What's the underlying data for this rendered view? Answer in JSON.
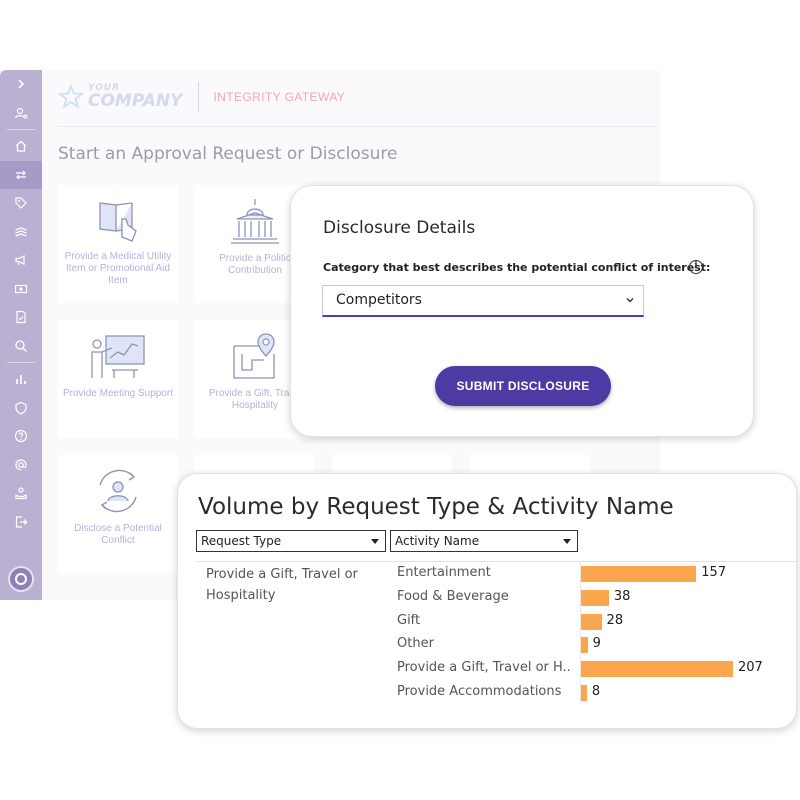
{
  "brand": {
    "your": "YOUR",
    "company": "COMPANY",
    "gateway": "INTEGRITY GATEWAY"
  },
  "sidebar": {
    "items": [
      {
        "icon": "chevron-right-icon"
      },
      {
        "icon": "user-settings-icon"
      },
      {
        "icon": "home-icon"
      },
      {
        "icon": "switch-icon"
      },
      {
        "icon": "tag-icon"
      },
      {
        "icon": "layers-icon"
      },
      {
        "icon": "megaphone-icon"
      },
      {
        "icon": "money-icon"
      },
      {
        "icon": "document-check-icon"
      },
      {
        "icon": "search-gear-icon"
      },
      {
        "icon": "bar-chart-icon"
      },
      {
        "icon": "shield-icon"
      },
      {
        "icon": "help-icon"
      },
      {
        "icon": "at-sign-icon"
      },
      {
        "icon": "hand-user-icon"
      },
      {
        "icon": "logout-icon"
      }
    ],
    "accent": "#b9b0d2"
  },
  "page": {
    "title": "Start an Approval Request or Disclosure"
  },
  "tiles": [
    {
      "label": "Provide a Medical Utility Item or Promotional Aid Item",
      "icon": "book-hand-icon"
    },
    {
      "label": "Provide a Politic Contribution",
      "icon": "capitol-building-icon"
    },
    {
      "label": "Provide Meeting Support",
      "icon": "presentation-icon"
    },
    {
      "label": "Provide a Gift, Tra or Hospitality",
      "icon": "map-pin-icon"
    },
    {
      "label": "Disclose a Potential Conflict",
      "icon": "user-cycle-icon"
    }
  ],
  "modal": {
    "title": "Disclosure Details",
    "question": "Category that best describes the potential conflict of interest:",
    "info": "i",
    "selected": "Competitors",
    "submit": "SUBMIT DISCLOSURE",
    "accent": "#4e3aa3"
  },
  "chart": {
    "title": "Volume by Request Type & Activity Name",
    "filters": [
      {
        "label": "Request Type"
      },
      {
        "label": "Activity Name"
      }
    ],
    "request_type_line1": "Provide a Gift, Travel or",
    "request_type_line2": "Hospitality",
    "bar_color": "#fba64c"
  },
  "chart_data": {
    "type": "bar",
    "orientation": "horizontal",
    "title": "Volume by Request Type & Activity Name",
    "group": "Provide a Gift, Travel or Hospitality",
    "categories": [
      "Entertainment",
      "Food & Beverage",
      "Gift",
      "Other",
      "Provide a Gift, Travel or H..",
      "Provide Accommodations"
    ],
    "values": [
      157,
      38,
      28,
      9,
      207,
      8
    ],
    "xlim": [
      0,
      207
    ],
    "grid": false
  }
}
